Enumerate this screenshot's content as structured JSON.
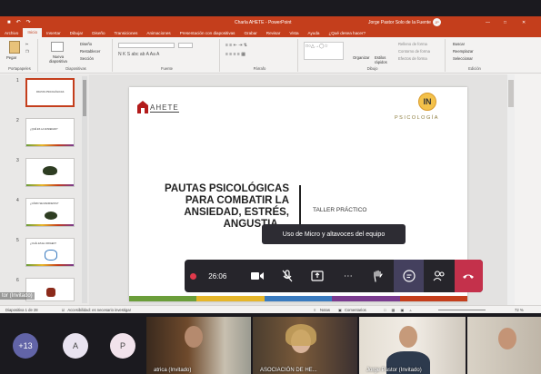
{
  "window": {
    "title": "Charla AHETE - PowerPoint",
    "user": "Jorge Pastor Solo de la Fuente",
    "avatar_initials": "JP"
  },
  "ribbon_tabs": [
    "Archivo",
    "Inicio",
    "Insertar",
    "Dibujar",
    "Diseño",
    "Transiciones",
    "Animaciones",
    "Presentación con diapositivas",
    "Grabar",
    "Revisar",
    "Vista",
    "Ayuda",
    "¿Qué desea hacer?"
  ],
  "ribbon": {
    "paste": "Pegar",
    "new_slide": "Nueva diapositiva",
    "layout": "Diseño",
    "reset": "Restablecer",
    "section": "Sección",
    "group_clipboard": "Portapapeles",
    "group_slides": "Diapositivas",
    "group_font": "Fuente",
    "group_paragraph": "Párrafo",
    "group_drawing": "Dibujo",
    "group_editing": "Edición",
    "organize": "Organizar",
    "quick_styles": "Estilos rápidos",
    "shape_fill": "Relleno de forma",
    "shape_outline": "Contorno de forma",
    "shape_effects": "Efectos de forma",
    "find": "Buscar",
    "replace": "Reemplazar",
    "select": "Seleccionar"
  },
  "thumbnails": [
    {
      "num": "1",
      "text": "PAUTAS PSICOLÓGICAS"
    },
    {
      "num": "2",
      "text": "¿QUÉ ES LA ANSIEDAD?"
    },
    {
      "num": "3",
      "text": ""
    },
    {
      "num": "4",
      "text": "¿CÓMO SE MANIFIESTA?"
    },
    {
      "num": "5",
      "text": "¿CUÁL ES EL ORIGEN?"
    },
    {
      "num": "6",
      "text": ""
    }
  ],
  "slide": {
    "logo_left": "AHETE",
    "logo_right_mark": "IN",
    "logo_right_text": "PSICOLOGÍA",
    "title_lines": [
      "PAUTAS PSICOLÓGICAS",
      "PARA COMBATIR LA",
      "ANSIEDAD, ESTRÉS,",
      "ANGUSTIA ..."
    ],
    "subtitle": "TALLER PRÁCTICO"
  },
  "status": {
    "slide_count": "Diapositiva 1 de 28",
    "accessibility": "Accesibilidad: es necesario investigar",
    "notes": "Notas",
    "comments": "Comentarios",
    "zoom": "72 %"
  },
  "tooltip": "Uso de Micro y altavoces del equipo",
  "call": {
    "timer": "26:06",
    "partial_label": "tor (Invitado)"
  },
  "participants": {
    "overflow": "+13",
    "circles": [
      {
        "initial": "A",
        "color": "#e9e3f0"
      },
      {
        "initial": "P",
        "color": "#f2e3ec"
      }
    ],
    "videos": [
      {
        "name": "atrica (Invitado)"
      },
      {
        "name": "ASOCIACIÓN DE HE..."
      },
      {
        "name": "Jorge Pastor (Invitado)"
      },
      {
        "name": ""
      }
    ]
  },
  "colors": {
    "accent": "#c43e1c",
    "hangup": "#c4314b",
    "overflow": "#6264a7"
  }
}
